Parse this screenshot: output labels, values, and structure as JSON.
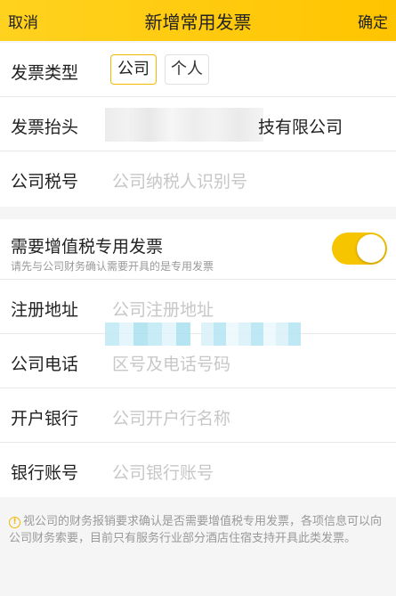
{
  "nav": {
    "cancel": "取消",
    "title": "新增常用发票",
    "confirm": "确定"
  },
  "invoice_type": {
    "label": "发票类型",
    "options": [
      "公司",
      "个人"
    ],
    "selected": "公司"
  },
  "invoice_header": {
    "label": "发票抬头",
    "value_visible": "技有限公司"
  },
  "tax_id": {
    "label": "公司税号",
    "placeholder": "公司纳税人识别号"
  },
  "vat": {
    "label": "需要增值税专用发票",
    "hint": "请先与公司财务确认需要开具的是专用发票",
    "enabled": true
  },
  "fields": [
    {
      "label": "注册地址",
      "placeholder": "公司注册地址"
    },
    {
      "label": "公司电话",
      "placeholder": "区号及电话号码"
    },
    {
      "label": "开户银行",
      "placeholder": "公司开户行名称"
    },
    {
      "label": "银行账号",
      "placeholder": "公司银行账号"
    }
  ],
  "notice": "视公司的财务报销要求确认是否需要增值税专用发票，各项信息可以向公司财务索要，目前只有服务行业部分酒店住宿支持开具此类发票。",
  "colors": {
    "accent": "#f7c400",
    "nav_bg": "#ffd21f",
    "placeholder": "#c7c7c7"
  }
}
